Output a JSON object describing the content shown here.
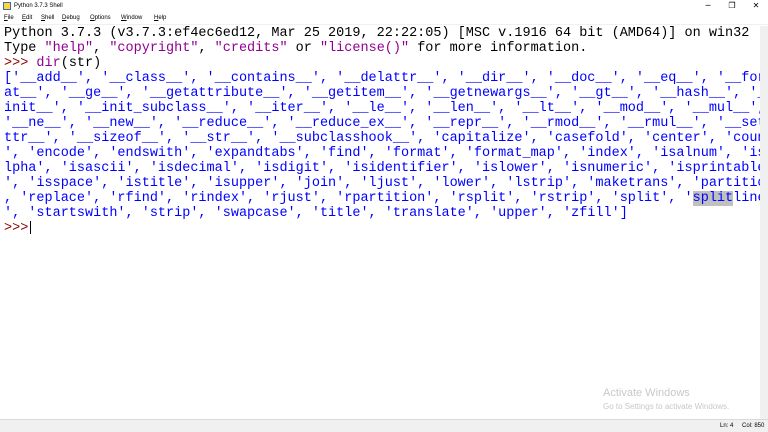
{
  "window": {
    "title": "Python 3.7.3 Shell"
  },
  "menu": {
    "items": [
      {
        "u": "F",
        "rest": "ile"
      },
      {
        "u": "E",
        "rest": "dit"
      },
      {
        "u": "S",
        "rest": "hell"
      },
      {
        "u": "D",
        "rest": "ebug"
      },
      {
        "u": "O",
        "rest": "ptions"
      },
      {
        "u": "W",
        "rest": "indow"
      },
      {
        "u": "H",
        "rest": "elp"
      }
    ]
  },
  "shell": {
    "banner1": "Python 3.7.3 (v3.7.3:ef4ec6ed12, Mar 25 2019, 22:22:05) [MSC v.1916 64 bit (AMD64)] on win32",
    "banner2_pre": "Type ",
    "banner2_s1": "\"help\"",
    "banner2_c1": ", ",
    "banner2_s2": "\"copyright\"",
    "banner2_c2": ", ",
    "banner2_s3": "\"credits\"",
    "banner2_c3": " or ",
    "banner2_s4": "\"license()\"",
    "banner2_post": " for more information.",
    "prompt": ">>> ",
    "command_fn": "dir",
    "command_arg": "(str)",
    "output_lines": [
      "['__add__', '__class__', '__contains__', '__delattr__', '__dir__', '__doc__', '__eq__', '__form",
      "at__', '__ge__', '__getattribute__', '__getitem__', '__getnewargs__', '__gt__', '__hash__', '__",
      "init__', '__init_subclass__', '__iter__', '__le__', '__len__', '__lt__', '__mod__', '__mul__',",
      "'__ne__', '__new__', '__reduce__', '__reduce_ex__', '__repr__', '__rmod__', '__rmul__', '__seta",
      "ttr__', '__sizeof__', '__str__', '__subclasshook__', 'capitalize', 'casefold', 'center', 'count",
      "', 'encode', 'endswith', 'expandtabs', 'find', 'format', 'format_map', 'index', 'isalnum', 'isa",
      "lpha', 'isascii', 'isdecimal', 'isdigit', 'isidentifier', 'islower', 'isnumeric', 'isprintable'",
      "', 'isspace', 'istitle', 'isupper', 'join', 'ljust', 'lower', 'lstrip', 'maketrans', 'partition'"
    ],
    "line9_pre": ", 'replace', 'rfind', 'rindex', 'rjust', 'rpartition', 'rsplit', 'rstrip', 'split', '",
    "line9_sel": "split",
    "line9_post": "lines",
    "line10": "', 'startswith', 'strip', 'swapcase', 'title', 'translate', 'upper', 'zfill']",
    "final_prompt": ">>>"
  },
  "watermark": {
    "title": "Activate Windows",
    "subtitle": "Go to Settings to activate Windows."
  },
  "status": {
    "line": "Ln: 4",
    "col": "Col: 850"
  }
}
